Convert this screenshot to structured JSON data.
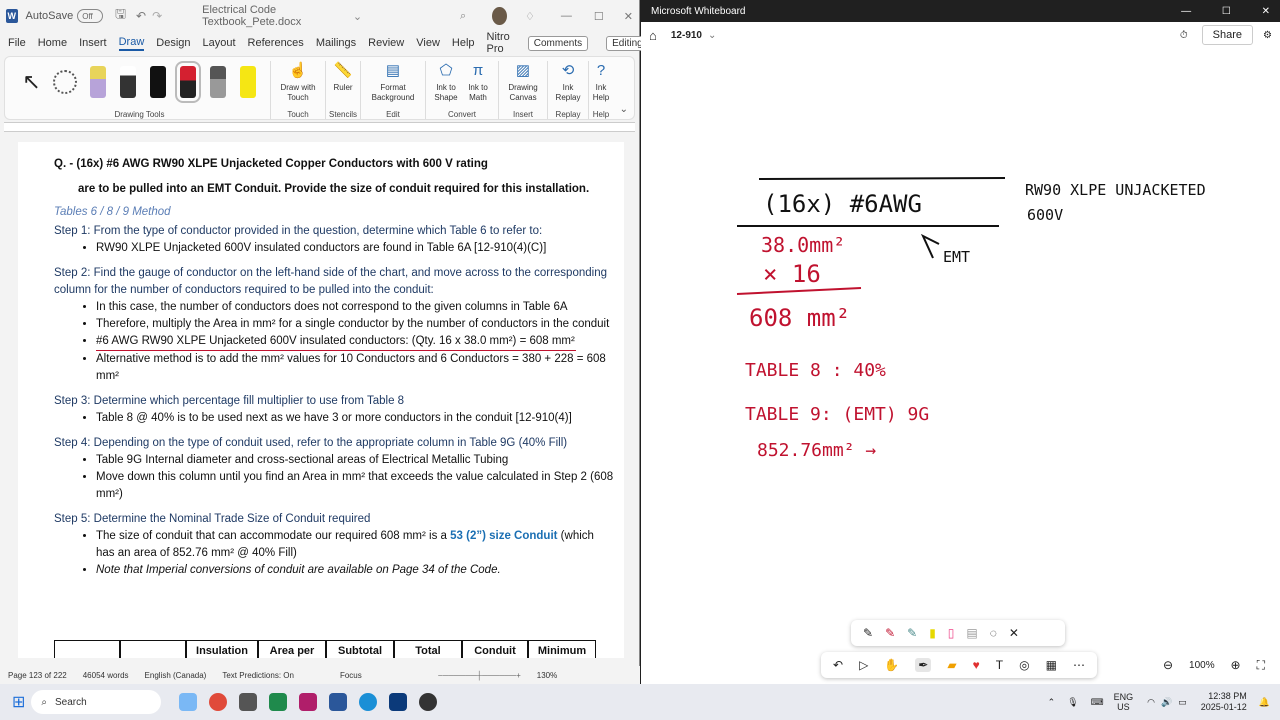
{
  "word": {
    "autosave": "AutoSave",
    "autosave_state": "Off",
    "doc_title": "Electrical Code Textbook_Pete.docx",
    "menu": [
      "File",
      "Home",
      "Insert",
      "Draw",
      "Design",
      "Layout",
      "References",
      "Mailings",
      "Review",
      "View",
      "Help",
      "Nitro Pro"
    ],
    "comments_label": "Comments",
    "editing_label": "Editing",
    "ribbon": {
      "drawing_tools": "Drawing Tools",
      "touch": {
        "button": "Draw with Touch",
        "group": "Touch"
      },
      "stencils": {
        "button": "Ruler",
        "group": "Stencils"
      },
      "edit": {
        "button": "Format Background",
        "group": "Edit"
      },
      "convert": {
        "b1": "Ink to Shape",
        "b2": "Ink to Math",
        "group": "Convert"
      },
      "insert": {
        "button": "Drawing Canvas",
        "group": "Insert"
      },
      "replay": {
        "button": "Ink Replay",
        "group": "Replay"
      },
      "help": {
        "button": "Ink Help",
        "group": "Help"
      }
    },
    "doc": {
      "q1": "Q. - (16x) #6 AWG RW90 XLPE Unjacketed Copper Conductors with 600 V rating",
      "q2": "are to be pulled into an EMT Conduit. Provide the size of conduit required for this installation.",
      "method": "Tables 6 / 8 / 9 Method",
      "s1": "Step 1: From the type of conductor provided in the question, determine which Table 6 to refer to:",
      "s1b": [
        "RW90 XLPE Unjacketed 600V insulated conductors are found in Table 6A [12-910(4)(C)]"
      ],
      "s2": "Step 2: Find the gauge of conductor on the left-hand side of the chart, and move across to the corresponding column for the number of conductors required to be pulled into the conduit:",
      "s2b": [
        "In this case, the number of conductors does not correspond to the given columns in Table 6A",
        "Therefore, multiply the Area in mm² for a single conductor by the number of conductors in the conduit",
        "#6 AWG RW90 XLPE Unjacketed 600V insulated conductors: (Qty. 16 x 38.0 mm²) = 608 mm²",
        "Alternative method is to add the mm² values for 10 Conductors and 6 Conductors = 380 + 228 = 608 mm²"
      ],
      "s3": "Step 3: Determine which percentage fill multiplier to use from Table 8",
      "s3b": [
        "Table 8 @ 40% is to be used next as we have 3 or more conductors in the conduit [12-910(4)]"
      ],
      "s4": "Step 4: Depending on the type of conduit used, refer to the appropriate column in Table 9G (40% Fill)",
      "s4b": [
        "Table 9G Internal diameter and cross-sectional areas of Electrical Metallic Tubing",
        "Move down this column until you find an Area in mm² that exceeds the value calculated in Step 2 (608 mm²)"
      ],
      "s5": "Step 5: Determine the Nominal Trade Size of Conduit required",
      "s5b1_pre": "The size of conduit that can accommodate our required 608 mm² is a ",
      "s5b1_em": "53 (2”) size Conduit",
      "s5b1_post": " (which has an area of 852.76 mm² @ 40% Fill)",
      "s5b2": "Note that Imperial conversions of conduit are available on Page 34 of the Code.",
      "table_headers": [
        "",
        "",
        "Insulation",
        "Area per",
        "Subtotal",
        "Total",
        "Conduit",
        "Minimum"
      ]
    },
    "status": {
      "page": "Page 123 of 222",
      "words": "46054 words",
      "lang": "English (Canada)",
      "predict": "Text Predictions: On",
      "focus": "Focus",
      "zoom": "130%"
    }
  },
  "whiteboard": {
    "app_title": "Microsoft Whiteboard",
    "board_name": "12-910",
    "share": "Share",
    "zoom": "100%",
    "ink": {
      "t1": "(16x) #6AWG",
      "t2": "RW90 XLPE UNJACKETED",
      "t3": "600V",
      "t4": "38.0mm²",
      "t5": "× 16",
      "t6": "608 mm²",
      "t7": "EMT",
      "t8": "TABLE 8 : 40%",
      "t9": "TABLE 9: (EMT) 9G",
      "t10": "852.76mm² →"
    }
  },
  "taskbar": {
    "search": "Search",
    "lang1": "ENG",
    "lang2": "US",
    "time": "12:38 PM",
    "date": "2025-01-12"
  }
}
